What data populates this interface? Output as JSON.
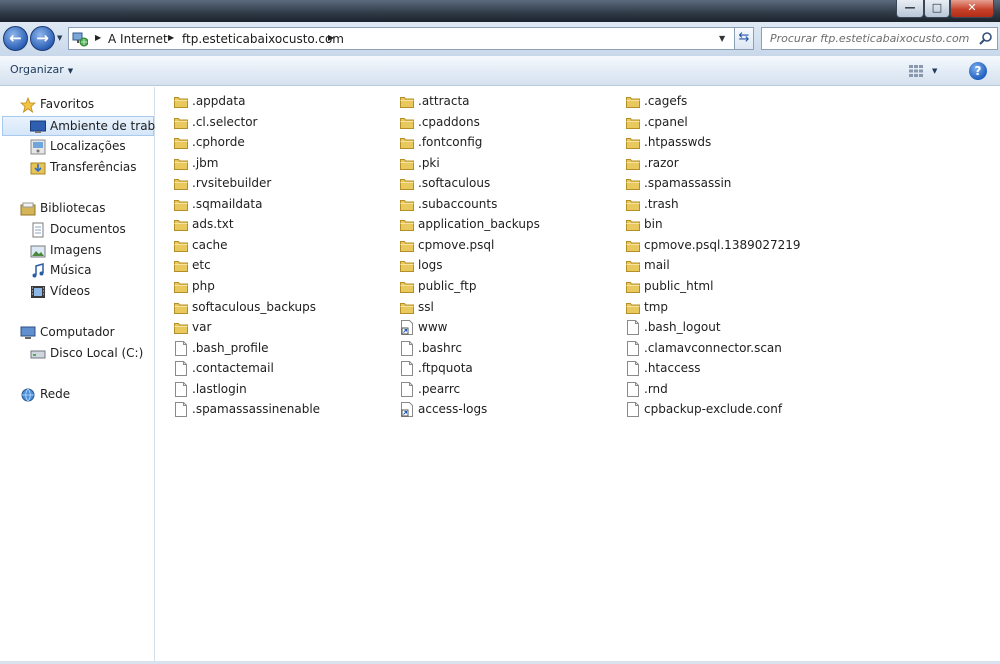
{
  "window": {
    "minimize_glyph": "—",
    "maximize_glyph": "□",
    "close_glyph": "✕"
  },
  "address_bar": {
    "breadcrumbs": [
      "A Internet",
      "ftp.esteticabaixocusto.com"
    ],
    "search_placeholder": "Procurar ftp.esteticabaixocusto.com"
  },
  "toolbar": {
    "organize_label": "Organizar"
  },
  "sidebar": {
    "favorites": {
      "label": "Favoritos",
      "items": [
        "Ambiente de trabalho",
        "Localizações",
        "Transferências"
      ]
    },
    "libraries": {
      "label": "Bibliotecas",
      "items": [
        "Documentos",
        "Imagens",
        "Música",
        "Vídeos"
      ]
    },
    "computer": {
      "label": "Computador",
      "items": [
        "Disco Local (C:)"
      ]
    },
    "network": {
      "label": "Rede"
    }
  },
  "files": [
    {
      "name": ".appdata",
      "type": "folder"
    },
    {
      "name": ".cl.selector",
      "type": "folder"
    },
    {
      "name": ".cphorde",
      "type": "folder"
    },
    {
      "name": ".jbm",
      "type": "folder"
    },
    {
      "name": ".rvsitebuilder",
      "type": "folder"
    },
    {
      "name": ".sqmaildata",
      "type": "folder"
    },
    {
      "name": "ads.txt",
      "type": "folder"
    },
    {
      "name": "cache",
      "type": "folder"
    },
    {
      "name": "etc",
      "type": "folder"
    },
    {
      "name": "php",
      "type": "folder"
    },
    {
      "name": "softaculous_backups",
      "type": "folder"
    },
    {
      "name": "var",
      "type": "folder"
    },
    {
      "name": ".bash_profile",
      "type": "file"
    },
    {
      "name": ".contactemail",
      "type": "file"
    },
    {
      "name": ".lastlogin",
      "type": "file"
    },
    {
      "name": ".spamassassinenable",
      "type": "file"
    },
    {
      "name": ".attracta",
      "type": "folder"
    },
    {
      "name": ".cpaddons",
      "type": "folder"
    },
    {
      "name": ".fontconfig",
      "type": "folder"
    },
    {
      "name": ".pki",
      "type": "folder"
    },
    {
      "name": ".softaculous",
      "type": "folder"
    },
    {
      "name": ".subaccounts",
      "type": "folder"
    },
    {
      "name": "application_backups",
      "type": "folder"
    },
    {
      "name": "cpmove.psql",
      "type": "folder"
    },
    {
      "name": "logs",
      "type": "folder"
    },
    {
      "name": "public_ftp",
      "type": "folder"
    },
    {
      "name": "ssl",
      "type": "folder"
    },
    {
      "name": "www",
      "type": "shortcut"
    },
    {
      "name": ".bashrc",
      "type": "file"
    },
    {
      "name": ".ftpquota",
      "type": "file"
    },
    {
      "name": ".pearrc",
      "type": "file"
    },
    {
      "name": "access-logs",
      "type": "shortcut"
    },
    {
      "name": ".cagefs",
      "type": "folder"
    },
    {
      "name": ".cpanel",
      "type": "folder"
    },
    {
      "name": ".htpasswds",
      "type": "folder"
    },
    {
      "name": ".razor",
      "type": "folder"
    },
    {
      "name": ".spamassassin",
      "type": "folder"
    },
    {
      "name": ".trash",
      "type": "folder"
    },
    {
      "name": "bin",
      "type": "folder"
    },
    {
      "name": "cpmove.psql.1389027219",
      "type": "folder"
    },
    {
      "name": "mail",
      "type": "folder"
    },
    {
      "name": "public_html",
      "type": "folder"
    },
    {
      "name": "tmp",
      "type": "folder"
    },
    {
      "name": ".bash_logout",
      "type": "file"
    },
    {
      "name": ".clamavconnector.scan",
      "type": "file"
    },
    {
      "name": ".htaccess",
      "type": "file"
    },
    {
      "name": ".rnd",
      "type": "file"
    },
    {
      "name": "cpbackup-exclude.conf",
      "type": "file"
    }
  ]
}
